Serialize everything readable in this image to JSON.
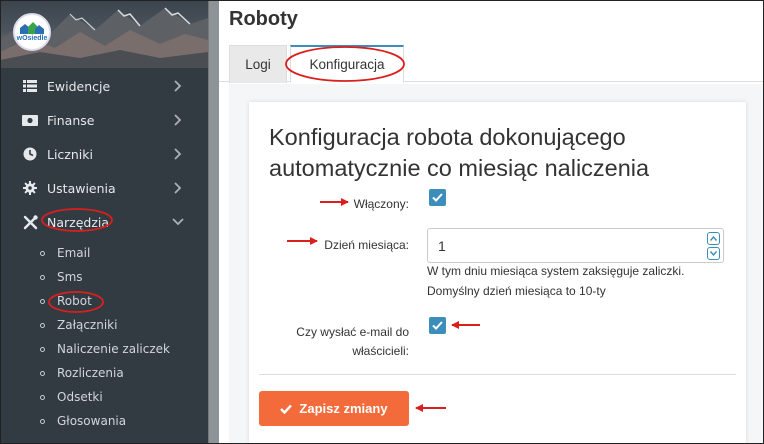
{
  "logo": {
    "text": "wOsiedle"
  },
  "sidebar": {
    "menu": [
      {
        "label": "Ewidencje",
        "icon": "list-icon"
      },
      {
        "label": "Finanse",
        "icon": "money-icon"
      },
      {
        "label": "Liczniki",
        "icon": "clock-icon"
      },
      {
        "label": "Ustawienia",
        "icon": "gear-icon"
      },
      {
        "label": "Narzędzia",
        "icon": "tools-icon"
      }
    ],
    "submenu": [
      {
        "label": "Email"
      },
      {
        "label": "Sms"
      },
      {
        "label": "Robot"
      },
      {
        "label": "Załączniki"
      },
      {
        "label": "Naliczenie zaliczek"
      },
      {
        "label": "Rozliczenia"
      },
      {
        "label": "Odsetki"
      },
      {
        "label": "Głosowania"
      }
    ]
  },
  "page": {
    "title": "Roboty"
  },
  "tabs": [
    {
      "label": "Logi"
    },
    {
      "label": "Konfiguracja"
    }
  ],
  "form": {
    "title": "Konfiguracja robota dokonującego automatycznie co miesiąc naliczenia",
    "enabled_label": "Włączony:",
    "enabled": true,
    "day_label": "Dzień miesiąca:",
    "day_value": "1",
    "help_line1": "W tym dniu miesiąca system zaksięguje zaliczki.",
    "help_line2": "Domyślny dzień miesiąca to 10-ty",
    "email_label_line1": "Czy wysłać e-mail do",
    "email_label_line2": "właścicieli:",
    "email_enabled": true,
    "save_label": "Zapisz zmiany"
  },
  "colors": {
    "accent": "#3c8dbc",
    "save": "#f36b3a",
    "annotation": "#d9201e",
    "sidebar": "#323a42"
  }
}
